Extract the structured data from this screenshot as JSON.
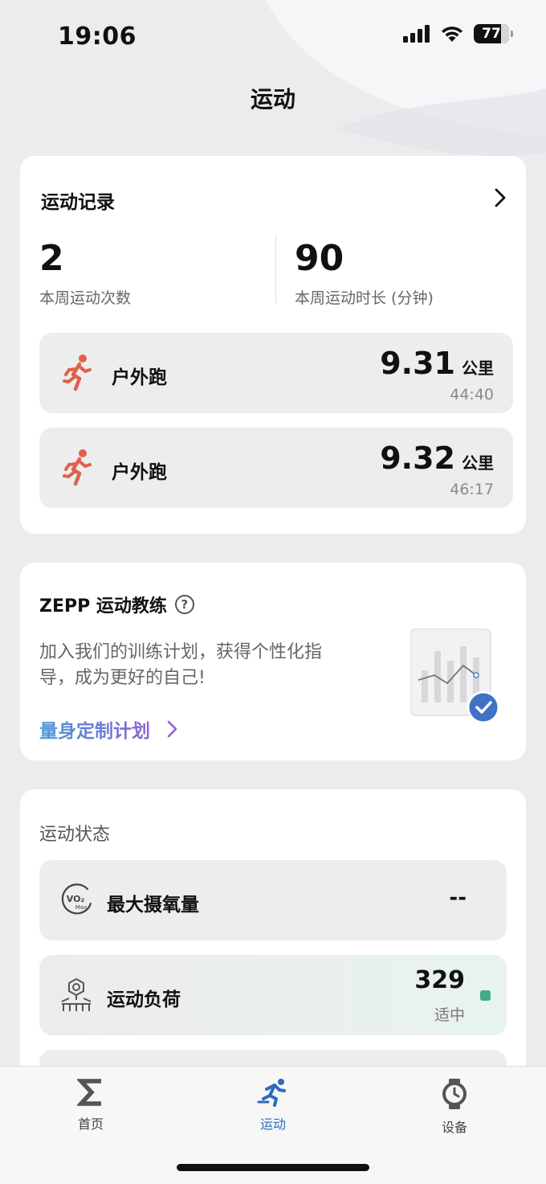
{
  "status_bar": {
    "time": "19:06",
    "battery": "77"
  },
  "page_title": "运动",
  "records": {
    "header": "运动记录",
    "weekly_count_value": "2",
    "weekly_count_label": "本周运动次数",
    "weekly_minutes_value": "90",
    "weekly_minutes_label": "本周运动时长 (分钟)",
    "items": [
      {
        "type": "户外跑",
        "distance": "9.31",
        "unit": "公里",
        "duration": "44:40"
      },
      {
        "type": "户外跑",
        "distance": "9.32",
        "unit": "公里",
        "duration": "46:17"
      }
    ]
  },
  "coach": {
    "title": "ZEPP 运动教练",
    "help_glyph": "?",
    "description": "加入我们的训练计划，获得个性化指导，成为更好的自己!",
    "link": "量身定制计划"
  },
  "status": {
    "title": "运动状态",
    "vo2": {
      "label": "最大摄氧量",
      "value": "--",
      "icon_text": "VO₂",
      "icon_sub": "Max"
    },
    "load": {
      "label": "运动负荷",
      "value": "329",
      "level": "适中",
      "level_color": "#3fae84"
    }
  },
  "tabs": [
    {
      "label": "首页",
      "icon": "sigma-icon"
    },
    {
      "label": "运动",
      "icon": "running-icon",
      "active": true
    },
    {
      "label": "设备",
      "icon": "watch-icon"
    }
  ],
  "colors": {
    "accent": "#2d6bb8",
    "run_icon": "#e0614a",
    "link_start": "#4a9ad8",
    "link_end": "#8b62d6"
  }
}
